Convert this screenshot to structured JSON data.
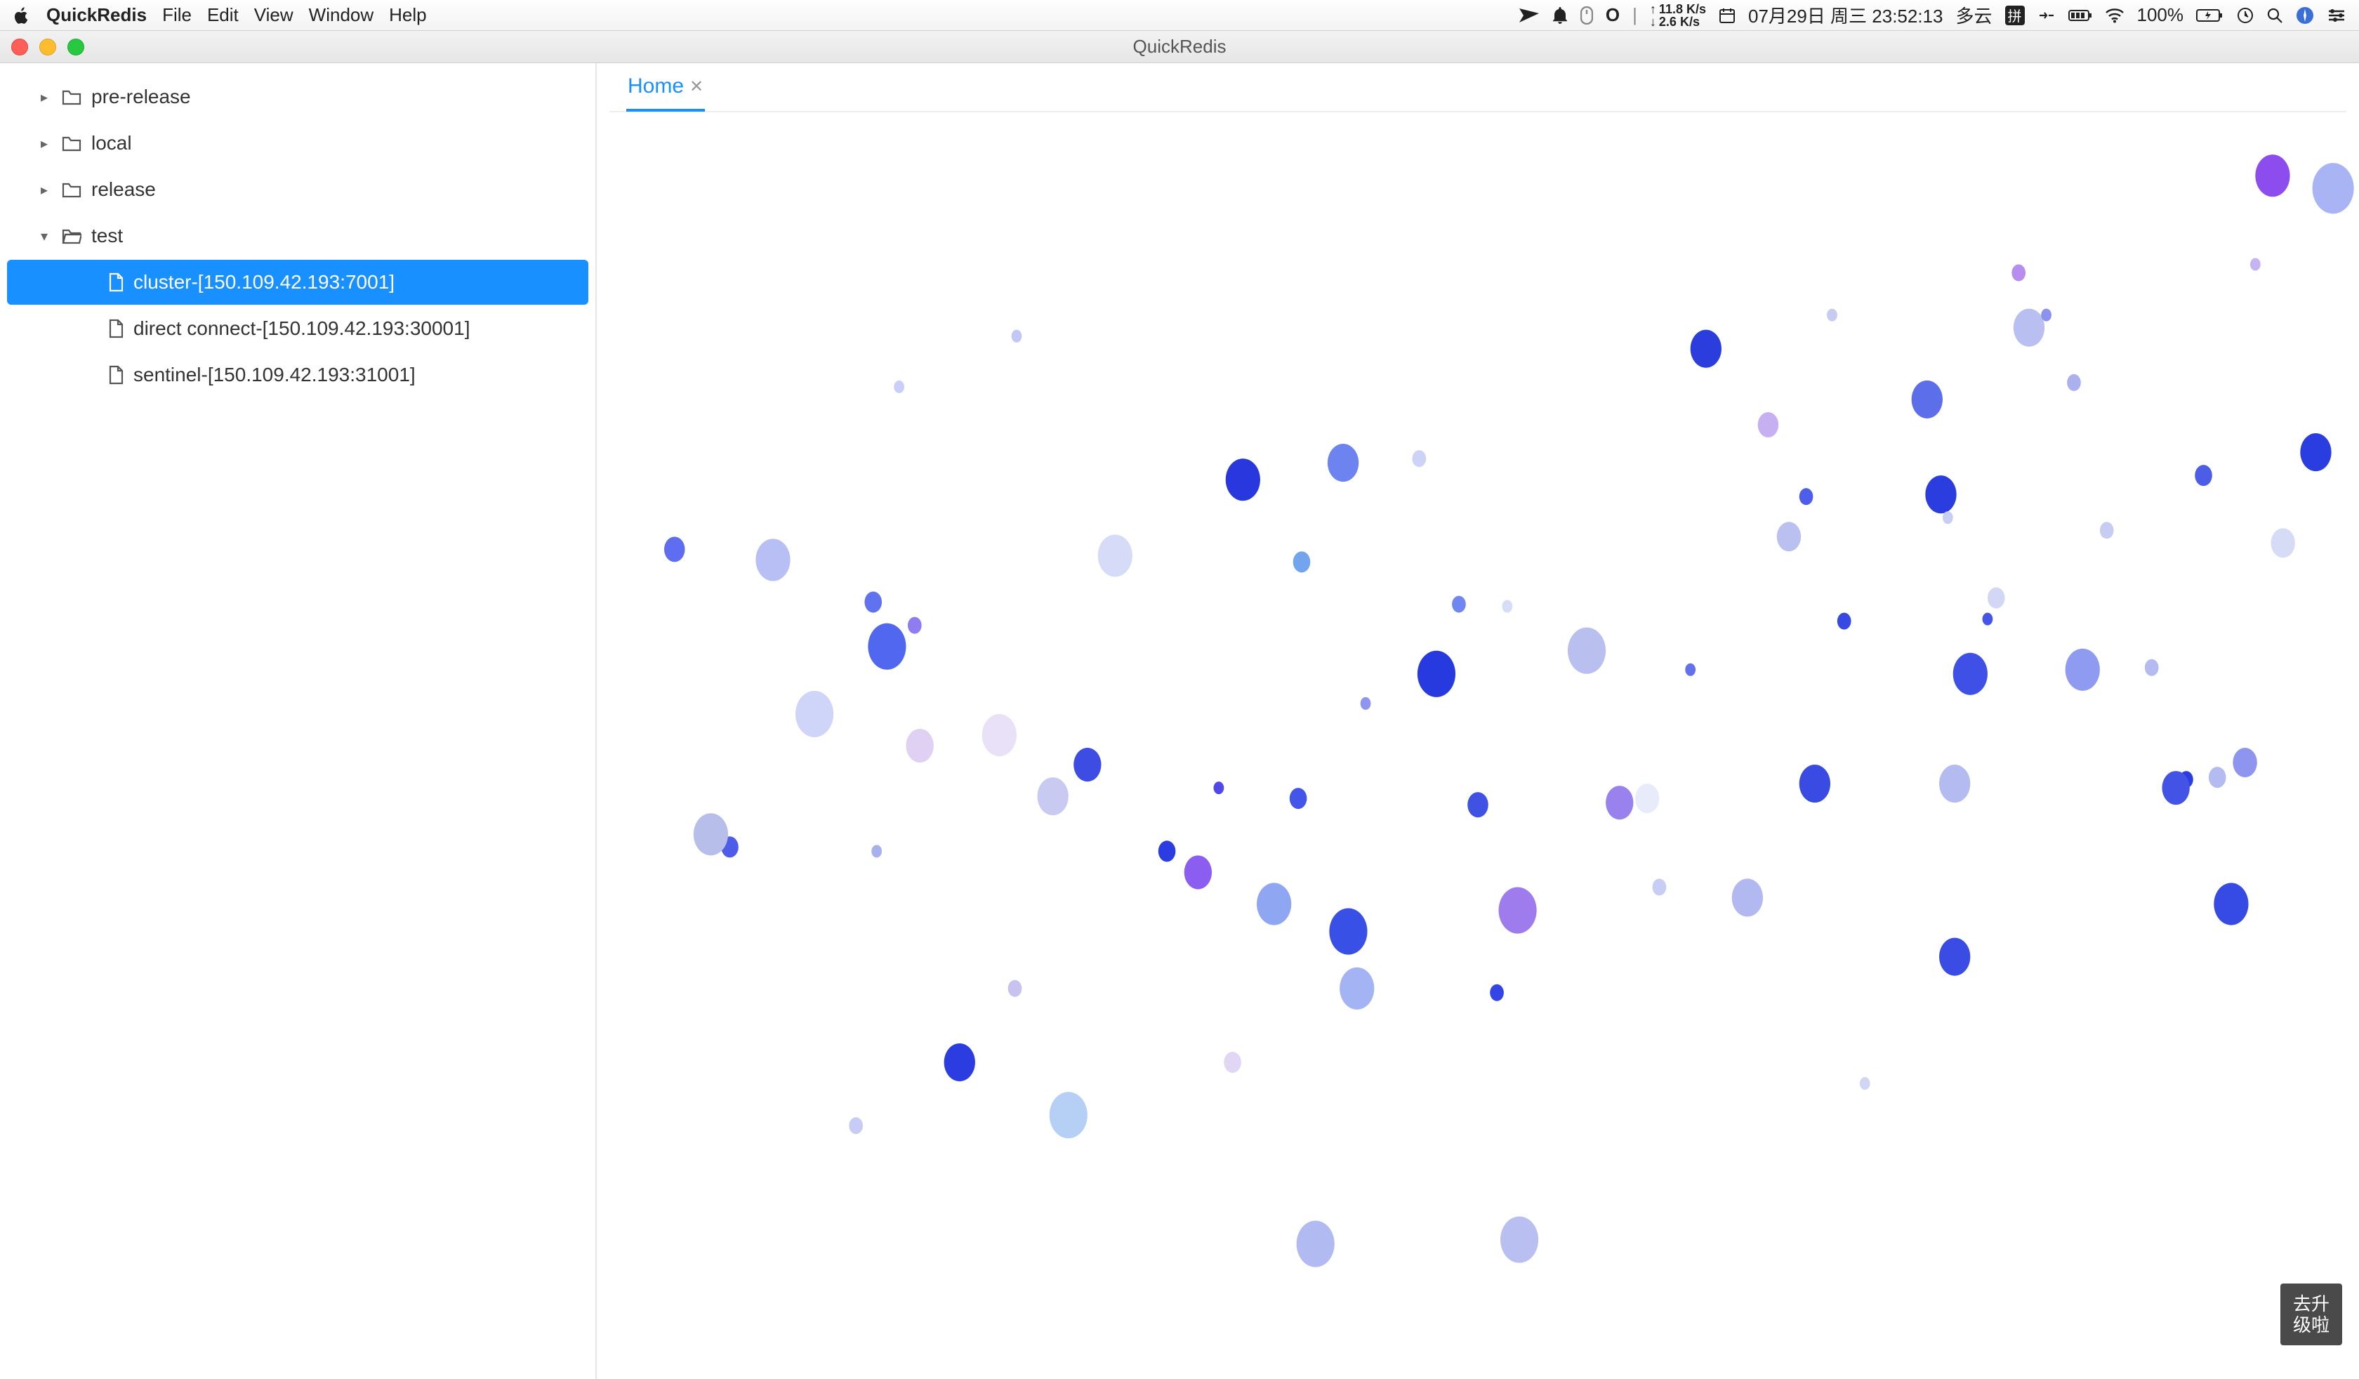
{
  "menubar": {
    "app_name": "QuickRedis",
    "items": [
      "File",
      "Edit",
      "View",
      "Window",
      "Help"
    ],
    "net_up": "11.8 K/s",
    "net_down": "2.6 K/s",
    "date_time": "07月29日 周三 23:52:13",
    "weather": "多云",
    "ime": "拼",
    "battery_percent": "100%"
  },
  "window": {
    "title": "QuickRedis",
    "tab_label": "Home",
    "upgrade_line1": "去升",
    "upgrade_line2": "级啦"
  },
  "sidebar": {
    "folders": [
      {
        "label": "pre-release",
        "expanded": false
      },
      {
        "label": "local",
        "expanded": false
      },
      {
        "label": "release",
        "expanded": false
      },
      {
        "label": "test",
        "expanded": true
      }
    ],
    "test_children": [
      {
        "label": "cluster-[150.109.42.193:7001]",
        "selected": true
      },
      {
        "label": "direct connect-[150.109.42.193:30001]",
        "selected": false
      },
      {
        "label": "sentinel-[150.109.42.193:31001]",
        "selected": false
      }
    ]
  },
  "chart_data": {
    "type": "scatter",
    "title": "",
    "xlabel": "",
    "ylabel": "",
    "xlim": [
      0,
      1000
    ],
    "ylim": [
      0,
      600
    ],
    "note": "Randomized decorative dot field. x/y are pixel-like coordinates in the content pane; r is dot radius; color is hex.",
    "series": [
      {
        "name": "dots",
        "points": [
          {
            "x": 45,
            "y": 207,
            "r": 6,
            "c": "#5f6ef0"
          },
          {
            "x": 77,
            "y": 348,
            "r": 5,
            "c": "#4e5de8"
          },
          {
            "x": 102,
            "y": 212,
            "r": 10,
            "c": "#b7bff5"
          },
          {
            "x": 160,
            "y": 232,
            "r": 5,
            "c": "#6072ef"
          },
          {
            "x": 126,
            "y": 285,
            "r": 11,
            "c": "#cfd5f8"
          },
          {
            "x": 66,
            "y": 342,
            "r": 10,
            "c": "#b7bee9"
          },
          {
            "x": 162,
            "y": 350,
            "r": 3,
            "c": "#a7b1ee"
          },
          {
            "x": 184,
            "y": 243,
            "r": 4,
            "c": "#8f7cf0"
          },
          {
            "x": 168,
            "y": 253,
            "r": 11,
            "c": "#5167ef"
          },
          {
            "x": 150,
            "y": 480,
            "r": 4,
            "c": "#c6ccf5"
          },
          {
            "x": 187,
            "y": 300,
            "r": 8,
            "c": "#e0d0f4"
          },
          {
            "x": 175,
            "y": 130,
            "r": 3,
            "c": "#c9cff7"
          },
          {
            "x": 210,
            "y": 450,
            "r": 9,
            "c": "#2b3de0"
          },
          {
            "x": 233,
            "y": 295,
            "r": 10,
            "c": "#e9e1f7"
          },
          {
            "x": 243,
            "y": 106,
            "r": 3,
            "c": "#c2c8f5"
          },
          {
            "x": 264,
            "y": 324,
            "r": 9,
            "c": "#c8caf2"
          },
          {
            "x": 273,
            "y": 475,
            "r": 11,
            "c": "#b5d0f4"
          },
          {
            "x": 284,
            "y": 309,
            "r": 8,
            "c": "#3d4de4"
          },
          {
            "x": 242,
            "y": 415,
            "r": 4,
            "c": "#c8c2ef"
          },
          {
            "x": 300,
            "y": 210,
            "r": 10,
            "c": "#d6dbf7"
          },
          {
            "x": 330,
            "y": 350,
            "r": 5,
            "c": "#2b3de0"
          },
          {
            "x": 348,
            "y": 360,
            "r": 8,
            "c": "#8b5ef1"
          },
          {
            "x": 368,
            "y": 450,
            "r": 5,
            "c": "#e1d7f5"
          },
          {
            "x": 374,
            "y": 174,
            "r": 10,
            "c": "#2937df"
          },
          {
            "x": 360,
            "y": 320,
            "r": 3,
            "c": "#5248e7"
          },
          {
            "x": 392,
            "y": 375,
            "r": 10,
            "c": "#8fa6f2"
          },
          {
            "x": 406,
            "y": 325,
            "r": 5,
            "c": "#4455e9"
          },
          {
            "x": 416,
            "y": 536,
            "r": 11,
            "c": "#b1bbf2"
          },
          {
            "x": 408,
            "y": 213,
            "r": 5,
            "c": "#73a5ef"
          },
          {
            "x": 432,
            "y": 166,
            "r": 9,
            "c": "#6d84f0"
          },
          {
            "x": 435,
            "y": 388,
            "r": 11,
            "c": "#3950e6"
          },
          {
            "x": 440,
            "y": 415,
            "r": 10,
            "c": "#a4b3f3"
          },
          {
            "x": 445,
            "y": 280,
            "r": 3,
            "c": "#8d95ee"
          },
          {
            "x": 476,
            "y": 164,
            "r": 4,
            "c": "#cdd3f6"
          },
          {
            "x": 486,
            "y": 266,
            "r": 11,
            "c": "#273ae0"
          },
          {
            "x": 499,
            "y": 233,
            "r": 4,
            "c": "#7187f0"
          },
          {
            "x": 510,
            "y": 328,
            "r": 6,
            "c": "#4052e3"
          },
          {
            "x": 521,
            "y": 417,
            "r": 4,
            "c": "#3444e5"
          },
          {
            "x": 533,
            "y": 378,
            "r": 11,
            "c": "#9e7cee"
          },
          {
            "x": 527,
            "y": 234,
            "r": 3,
            "c": "#d7dcf7"
          },
          {
            "x": 534,
            "y": 534,
            "r": 11,
            "c": "#b9c0f1"
          },
          {
            "x": 573,
            "y": 255,
            "r": 11,
            "c": "#b9c0f0"
          },
          {
            "x": 592,
            "y": 327,
            "r": 8,
            "c": "#9982ee"
          },
          {
            "x": 608,
            "y": 325,
            "r": 7,
            "c": "#e8ebfa"
          },
          {
            "x": 615,
            "y": 367,
            "r": 4,
            "c": "#c8cdf3"
          },
          {
            "x": 633,
            "y": 264,
            "r": 3,
            "c": "#6371ea"
          },
          {
            "x": 642,
            "y": 112,
            "r": 9,
            "c": "#2c3ddd"
          },
          {
            "x": 666,
            "y": 372,
            "r": 9,
            "c": "#b2b9f0"
          },
          {
            "x": 678,
            "y": 148,
            "r": 6,
            "c": "#c6b0f2"
          },
          {
            "x": 690,
            "y": 201,
            "r": 7,
            "c": "#bac1f1"
          },
          {
            "x": 700,
            "y": 182,
            "r": 4,
            "c": "#4d5fea"
          },
          {
            "x": 705,
            "y": 318,
            "r": 9,
            "c": "#3a4be3"
          },
          {
            "x": 715,
            "y": 96,
            "r": 3,
            "c": "#c7cbf2"
          },
          {
            "x": 722,
            "y": 241,
            "r": 4,
            "c": "#3848e2"
          },
          {
            "x": 734,
            "y": 460,
            "r": 3,
            "c": "#d1d6f5"
          },
          {
            "x": 770,
            "y": 136,
            "r": 9,
            "c": "#5c6eea"
          },
          {
            "x": 778,
            "y": 181,
            "r": 9,
            "c": "#2c3ddf"
          },
          {
            "x": 782,
            "y": 192,
            "r": 3,
            "c": "#c7cdf3"
          },
          {
            "x": 786,
            "y": 400,
            "r": 9,
            "c": "#3b4ce4"
          },
          {
            "x": 795,
            "y": 266,
            "r": 10,
            "c": "#3e50e5"
          },
          {
            "x": 786,
            "y": 318,
            "r": 9,
            "c": "#b4bbf1"
          },
          {
            "x": 810,
            "y": 230,
            "r": 5,
            "c": "#d2d7f5"
          },
          {
            "x": 805,
            "y": 240,
            "r": 3,
            "c": "#4556e6"
          },
          {
            "x": 823,
            "y": 76,
            "r": 4,
            "c": "#b78ef0"
          },
          {
            "x": 829,
            "y": 102,
            "r": 9,
            "c": "#b9c0f1"
          },
          {
            "x": 839,
            "y": 96,
            "r": 3,
            "c": "#8c93ee"
          },
          {
            "x": 855,
            "y": 128,
            "r": 4,
            "c": "#aab1ee"
          },
          {
            "x": 860,
            "y": 264,
            "r": 10,
            "c": "#8f9bf0"
          },
          {
            "x": 874,
            "y": 198,
            "r": 4,
            "c": "#c7ccf3"
          },
          {
            "x": 900,
            "y": 263,
            "r": 4,
            "c": "#b5bbf0"
          },
          {
            "x": 920,
            "y": 316,
            "r": 4,
            "c": "#2b3de0"
          },
          {
            "x": 930,
            "y": 172,
            "r": 5,
            "c": "#4c5ee7"
          },
          {
            "x": 914,
            "y": 320,
            "r": 8,
            "c": "#4253e5"
          },
          {
            "x": 946,
            "y": 375,
            "r": 10,
            "c": "#364ae4"
          },
          {
            "x": 938,
            "y": 315,
            "r": 5,
            "c": "#b4bbf1"
          },
          {
            "x": 960,
            "y": 72,
            "r": 3,
            "c": "#c6b4f2"
          },
          {
            "x": 954,
            "y": 308,
            "r": 7,
            "c": "#8e95ee"
          },
          {
            "x": 970,
            "y": 30,
            "r": 10,
            "c": "#8c4cee"
          },
          {
            "x": 976,
            "y": 204,
            "r": 7,
            "c": "#d7dcf6"
          },
          {
            "x": 1005,
            "y": 36,
            "r": 12,
            "c": "#a8b4f3"
          },
          {
            "x": 995,
            "y": 161,
            "r": 9,
            "c": "#2a3de0"
          }
        ]
      }
    ]
  }
}
